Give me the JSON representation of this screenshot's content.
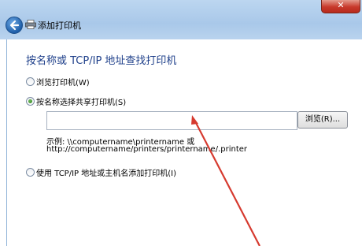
{
  "window": {
    "title": "添加打印机",
    "close_label": "✕"
  },
  "page": {
    "heading": "按名称或 TCP/IP 地址查找打印机"
  },
  "options": [
    {
      "label": "浏览打印机(W)",
      "selected": false
    },
    {
      "label": "按名称选择共享打印机(S)",
      "selected": true
    },
    {
      "label": "使用 TCP/IP 地址或主机名添加打印机(I)",
      "selected": false
    }
  ],
  "share_input": {
    "value": ""
  },
  "browse_button": {
    "label": "浏览(R)..."
  },
  "example": {
    "line1": "示例: \\\\computername\\printername 或",
    "line2": "http://computername/printers/printername/.printer"
  },
  "colors": {
    "heading": "#1e3f8a",
    "annotation_arrow": "#d63a2f"
  },
  "icons": [
    "back-arrow-icon",
    "printer-icon",
    "close-icon"
  ]
}
